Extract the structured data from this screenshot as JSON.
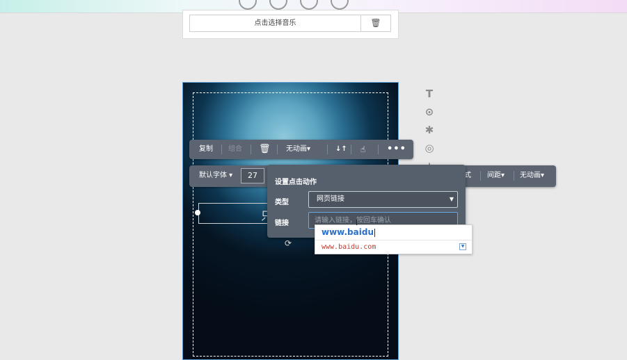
{
  "top_icons": [
    "square-icon",
    "image-icon",
    "document-icon",
    "check-icon"
  ],
  "music_panel": {
    "select_label": "点击选择音乐",
    "delete_icon": "trash-icon"
  },
  "side_tools": [
    {
      "name": "text-tool-icon",
      "glyph": "T"
    },
    {
      "name": "play-tool-icon",
      "glyph": "⊙"
    },
    {
      "name": "effect-tool-icon",
      "glyph": "✱"
    },
    {
      "name": "visibility-tool-icon",
      "glyph": "◎"
    },
    {
      "name": "star-tool-icon",
      "glyph": "★"
    }
  ],
  "toolbar1": {
    "copy": "复制",
    "group": "组合",
    "delete_icon": "trash-icon",
    "animation": "无动画▾",
    "layer_icon": "↓↑",
    "click_icon": "pointer-icon",
    "more": "•••"
  },
  "toolbar2": {
    "font": "默认字体 ▾",
    "font_size": "27",
    "style": "式",
    "spacing": "间距▾",
    "animation": "无动画▾"
  },
  "action_panel": {
    "title": "设置点击动作",
    "type_label": "类型",
    "type_value": "网页链接",
    "link_label": "链接",
    "link_placeholder": "请输入链接，按回车确认"
  },
  "autocomplete": {
    "typed": "www.baidu",
    "suggestion": "www.baidu.com"
  },
  "canvas": {
    "text_glyph": "只",
    "rotate_icon": "⟳"
  }
}
